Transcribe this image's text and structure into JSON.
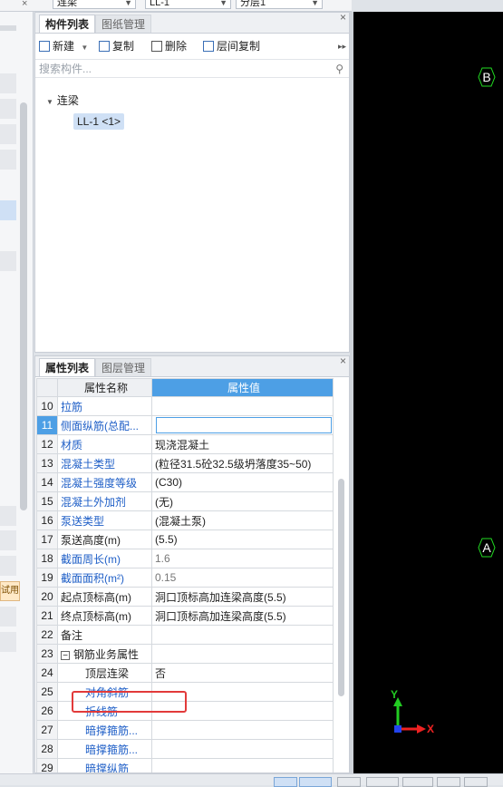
{
  "top": {
    "combo1": "连梁",
    "combo2": "LL-1",
    "combo3": "分层1"
  },
  "left_strip": {
    "button_label": "试用"
  },
  "component_panel": {
    "tabs": [
      "构件列表",
      "图纸管理"
    ],
    "toolbar": {
      "new": "新建",
      "copy": "复制",
      "delete": "删除",
      "floor_copy": "层间复制"
    },
    "search_placeholder": "搜索构件...",
    "tree": {
      "root": "连梁",
      "items": [
        "LL-1 <1>"
      ]
    }
  },
  "property_panel": {
    "tabs": [
      "属性列表",
      "图层管理"
    ],
    "headers": {
      "name": "属性名称",
      "value": "属性值"
    },
    "rows": [
      {
        "num": "10",
        "name": "拉筋",
        "value": ""
      },
      {
        "num": "11",
        "name": "侧面纵筋(总配...",
        "value": ""
      },
      {
        "num": "12",
        "name": "材质",
        "value": "现浇混凝土"
      },
      {
        "num": "13",
        "name": "混凝土类型",
        "value": "(粒径31.5砼32.5级坍落度35~50)"
      },
      {
        "num": "14",
        "name": "混凝土强度等级",
        "value": "(C30)"
      },
      {
        "num": "15",
        "name": "混凝土外加剂",
        "value": "(无)"
      },
      {
        "num": "16",
        "name": "泵送类型",
        "value": "(混凝土泵)"
      },
      {
        "num": "17",
        "name": "泵送高度(m)",
        "value": "(5.5)"
      },
      {
        "num": "18",
        "name": "截面周长(m)",
        "value": "1.6"
      },
      {
        "num": "19",
        "name": "截面面积(m²)",
        "value": "0.15"
      },
      {
        "num": "20",
        "name": "起点顶标高(m)",
        "value": "洞口顶标高加连梁高度(5.5)"
      },
      {
        "num": "21",
        "name": "终点顶标高(m)",
        "value": "洞口顶标高加连梁高度(5.5)"
      },
      {
        "num": "22",
        "name": "备注",
        "value": ""
      },
      {
        "num": "23",
        "name": "钢筋业务属性",
        "value": ""
      },
      {
        "num": "24",
        "name": "顶层连梁",
        "value": "否"
      },
      {
        "num": "25",
        "name": "对角斜筋",
        "value": ""
      },
      {
        "num": "26",
        "name": "折线筋",
        "value": ""
      },
      {
        "num": "27",
        "name": "暗撑箍筋...",
        "value": ""
      },
      {
        "num": "28",
        "name": "暗撑箍筋...",
        "value": ""
      },
      {
        "num": "29",
        "name": "暗撑纵筋",
        "value": ""
      }
    ],
    "group_toggle": "−"
  },
  "canvas": {
    "axis_labels": [
      "B",
      "A"
    ],
    "y_label": "Y",
    "x_label": "X"
  }
}
